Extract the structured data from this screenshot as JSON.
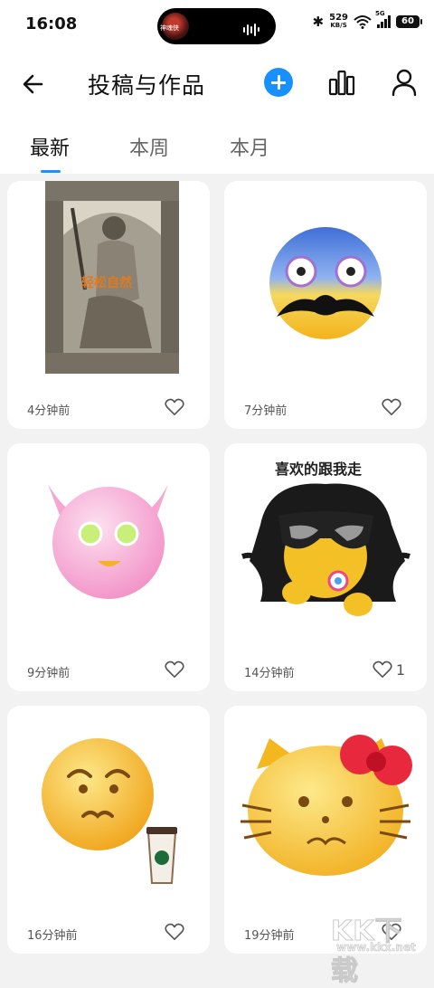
{
  "status": {
    "time": "16:08",
    "island_thumb_text": "神魂侠",
    "net_speed_value": "529",
    "net_speed_unit": "KB/S",
    "signal_tag": "5G",
    "battery": "60"
  },
  "header": {
    "title": "投稿与作品",
    "icons": [
      "back-arrow-icon",
      "plus-icon",
      "bar-chart-icon",
      "user-icon"
    ],
    "accent_color": "#1890ff"
  },
  "tabs": [
    {
      "label": "最新",
      "active": true
    },
    {
      "label": "本周",
      "active": false
    },
    {
      "label": "本月",
      "active": false
    }
  ],
  "cards": [
    {
      "image": "zeus-engraving",
      "overlay_text": "轻松自然",
      "time": "4分钟前",
      "likes": ""
    },
    {
      "image": "scared-mustache-emoji",
      "time": "7分钟前",
      "likes": ""
    },
    {
      "image": "pink-devil-emoji",
      "time": "9分钟前",
      "likes": ""
    },
    {
      "image": "sunglasses-longhair-emoji",
      "caption": "喜欢的跟我走",
      "time": "14分钟前",
      "likes": "1"
    },
    {
      "image": "smirk-coffee-emoji",
      "time": "16分钟前",
      "likes": ""
    },
    {
      "image": "hellokitty-emoji",
      "time": "19分钟前",
      "likes": ""
    }
  ],
  "watermark": {
    "text": "KK下载",
    "url": "www.kkx.net"
  }
}
